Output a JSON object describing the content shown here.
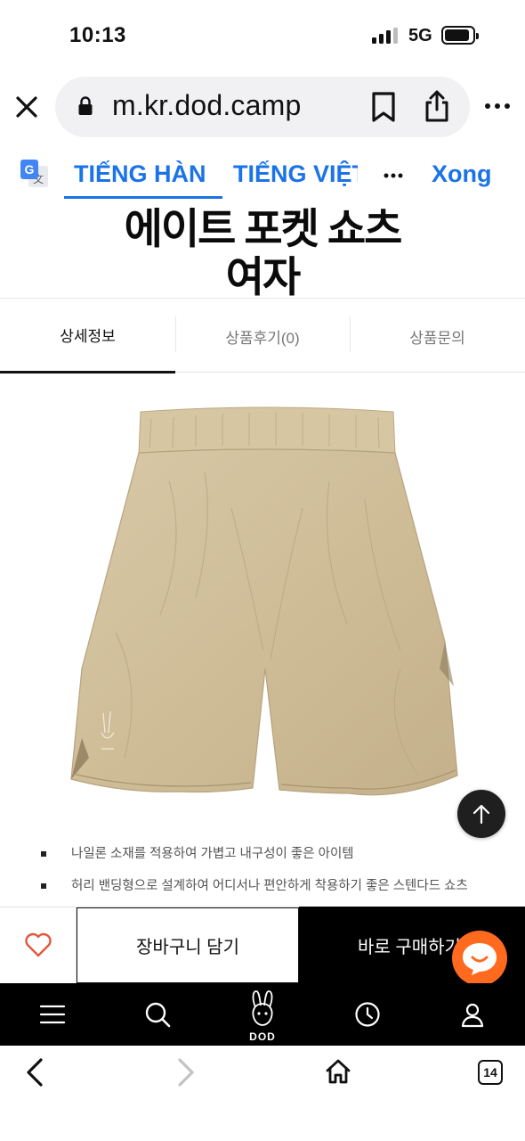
{
  "status_bar": {
    "time": "10:13",
    "network": "5G",
    "signal_bars_active": 3,
    "signal_bars_total": 4,
    "battery_level": 0.8
  },
  "browser": {
    "url": "m.kr.dod.camp",
    "tab_count": "14"
  },
  "translate_bar": {
    "source_language": "TIẾNG HÀN",
    "target_language": "TIẾNG VIỆT",
    "done_label": "Xong",
    "accent_color": "#1a73e8"
  },
  "product": {
    "title_line1": "에이트 포켓 쇼츠",
    "title_line2": "여자",
    "image_icon": "beige-shorts-photo",
    "descriptions": [
      "나일론 소재를 적용하여 가볍고 내구성이 좋은 아이템",
      "허리 밴딩형으로 설계하여 어디서나 편안하게 착용하기 좋은 스텐다드 쇼츠"
    ]
  },
  "tabs": [
    {
      "label": "상세정보",
      "active": true
    },
    {
      "label": "상품후기(0)",
      "active": false
    },
    {
      "label": "상품문의",
      "active": false
    }
  ],
  "purchase_bar": {
    "cart_label": "장바구니 담기",
    "buy_label": "바로 구매하기",
    "heart_color": "#e4573d",
    "chat_color": "#ff6a1f"
  },
  "site_nav": {
    "logo_text": "DOD",
    "icons": [
      "menu-icon",
      "search-icon",
      "dod-rabbit-logo",
      "recent-clock-icon",
      "user-icon"
    ]
  }
}
